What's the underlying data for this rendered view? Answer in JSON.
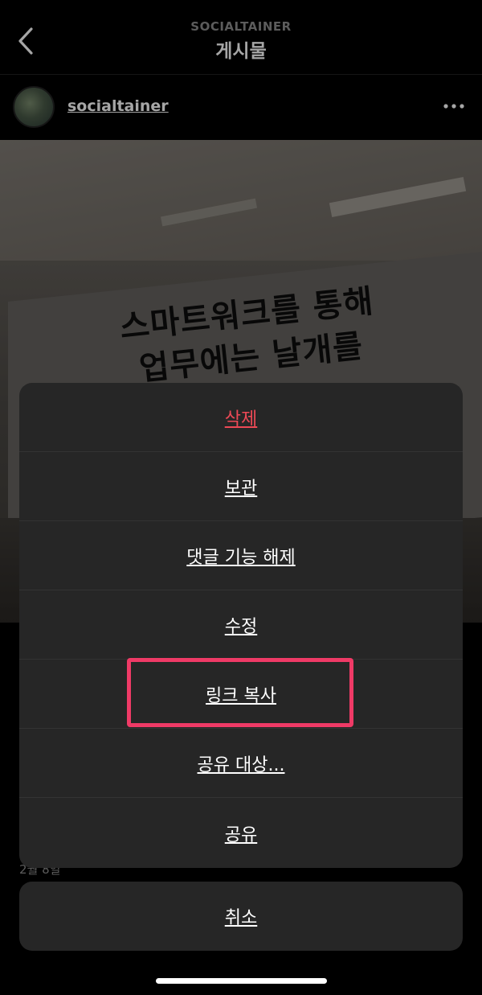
{
  "header": {
    "subtitle": "SOCIALTAINER",
    "title": "게시물",
    "back_icon": "chevron-left-icon"
  },
  "author": {
    "username": "socialtainer",
    "more_icon": "more-horizontal-icon"
  },
  "post_image": {
    "sign_line1": "스마트워크를 통해",
    "sign_line2": "업무에는 날개를"
  },
  "post_meta": {
    "date": "2월 8일"
  },
  "action_sheet": {
    "items": [
      {
        "label": "삭제",
        "style": "destructive"
      },
      {
        "label": "보관"
      },
      {
        "label": "댓글 기능 해제"
      },
      {
        "label": "수정"
      },
      {
        "label": "링크 복사",
        "highlighted": true
      },
      {
        "label": "공유 대상..."
      },
      {
        "label": "공유"
      }
    ],
    "cancel_label": "취소"
  },
  "colors": {
    "background": "#000000",
    "sheet": "#262626",
    "destructive": "#ed4956",
    "highlight": "#ef3a66",
    "secondary_text": "#8e8e8e"
  }
}
